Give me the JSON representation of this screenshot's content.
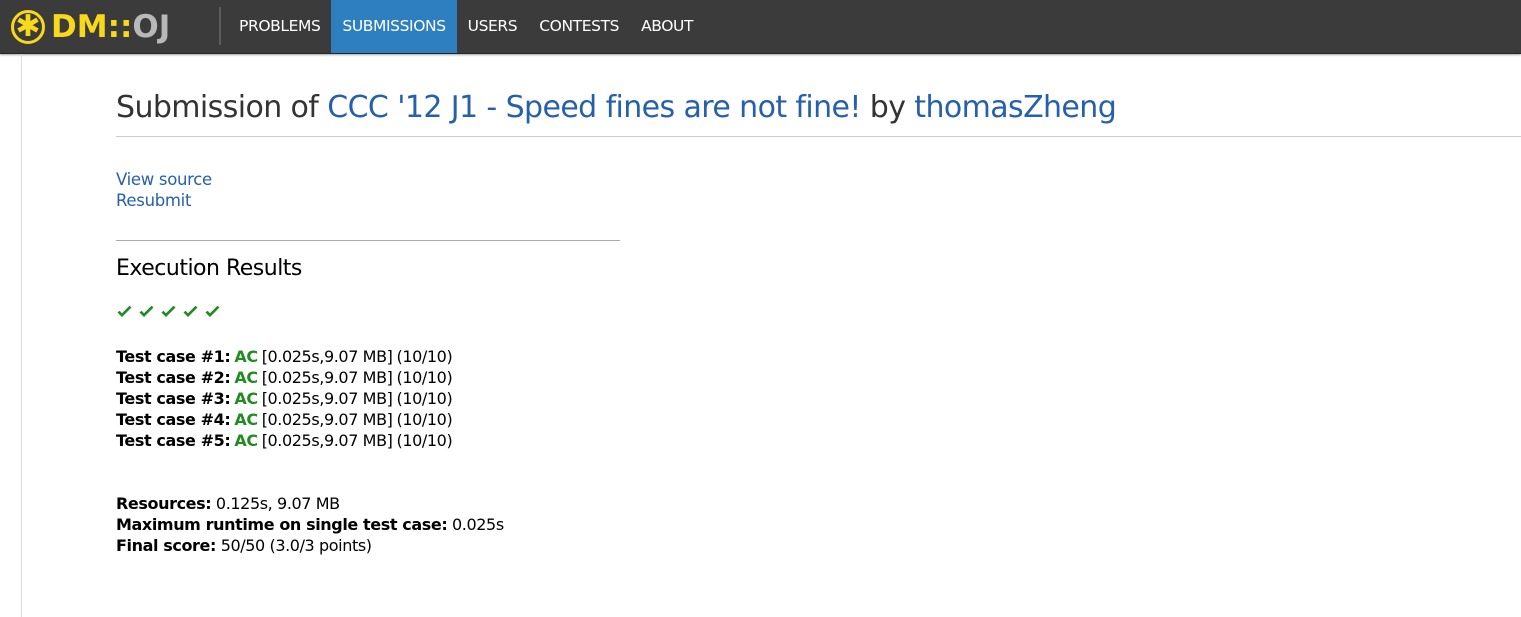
{
  "nav": {
    "logo_dm": "DM",
    "logo_sep": "::",
    "logo_oj": "OJ",
    "items": [
      {
        "label": "PROBLEMS",
        "active": false
      },
      {
        "label": "SUBMISSIONS",
        "active": true
      },
      {
        "label": "USERS",
        "active": false
      },
      {
        "label": "CONTESTS",
        "active": false
      },
      {
        "label": "ABOUT",
        "active": false
      }
    ]
  },
  "title": {
    "prefix": "Submission of",
    "problem": "CCC '12 J1 - Speed fines are not fine!",
    "by": "by",
    "user": "thomasZheng"
  },
  "links": {
    "view_source": "View source",
    "resubmit": "Resubmit"
  },
  "execution": {
    "heading": "Execution Results",
    "check_icons": [
      "check-icon",
      "check-icon",
      "check-icon",
      "check-icon",
      "check-icon"
    ],
    "cases": [
      {
        "label": "Test case #1:",
        "status": "AC",
        "time": "[0.025s,9.07 MB]",
        "points": "(10/10)"
      },
      {
        "label": "Test case #2:",
        "status": "AC",
        "time": "[0.025s,9.07 MB]",
        "points": "(10/10)"
      },
      {
        "label": "Test case #3:",
        "status": "AC",
        "time": "[0.025s,9.07 MB]",
        "points": "(10/10)"
      },
      {
        "label": "Test case #4:",
        "status": "AC",
        "time": "[0.025s,9.07 MB]",
        "points": "(10/10)"
      },
      {
        "label": "Test case #5:",
        "status": "AC",
        "time": "[0.025s,9.07 MB]",
        "points": "(10/10)"
      }
    ]
  },
  "summary": {
    "resources_label": "Resources:",
    "resources_value": "0.125s, 9.07 MB",
    "max_runtime_label": "Maximum runtime on single test case:",
    "max_runtime_value": "0.025s",
    "final_score_label": "Final score:",
    "final_score_value": "50/50 (3.0/3 points)"
  },
  "colors": {
    "navbar_bg": "#3b3b3b",
    "nav_active": "#2e7fc0",
    "logo_yellow": "#f8d81a",
    "logo_gray": "#b8b8b8",
    "link": "#2660ad",
    "ac_green": "#228b22"
  }
}
